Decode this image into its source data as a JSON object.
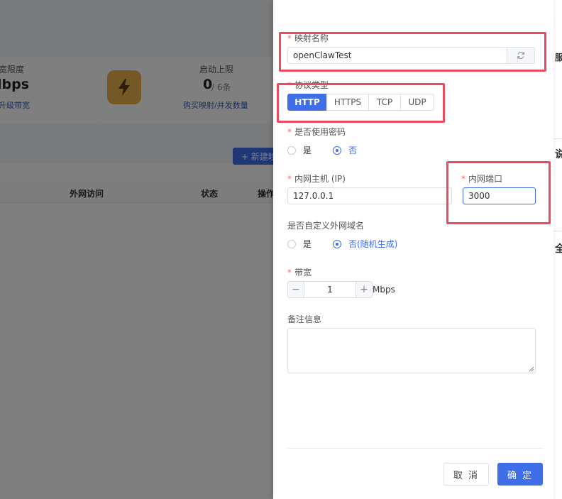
{
  "background": {
    "stat_1": {
      "label": "宽限度",
      "value": "lbps",
      "link": "升级带宽"
    },
    "stat_2": {
      "label": "启动上限",
      "value": "0",
      "suffix": "/ 6条",
      "link": "购买映射/并发数量"
    },
    "new_button": "+ 新建映射",
    "table_headers": [
      "外网访问",
      "状态",
      "操作"
    ],
    "right_edge_items": [
      "服",
      "说",
      "全"
    ]
  },
  "form": {
    "mapping_name": {
      "label": "映射名称",
      "required": true,
      "value": "openClawTest"
    },
    "protocol": {
      "label": "协议类型",
      "required": true,
      "options": [
        "HTTP",
        "HTTPS",
        "TCP",
        "UDP"
      ],
      "selected": "HTTP"
    },
    "use_password": {
      "label": "是否使用密码",
      "required": true,
      "options": [
        "是",
        "否"
      ],
      "selected": "否"
    },
    "lan_host": {
      "label": "内网主机 (IP)",
      "required": true,
      "value": "127.0.0.1"
    },
    "lan_port": {
      "label": "内网端口",
      "required": true,
      "value": "3000"
    },
    "custom_domain": {
      "label": "是否自定义外网域名",
      "required": false,
      "options": [
        "是",
        "否(随机生成)"
      ],
      "selected": "否(随机生成)"
    },
    "bandwidth": {
      "label": "带宽",
      "required": true,
      "value": "1",
      "unit": "Mbps",
      "decrement": "−",
      "increment": "+"
    },
    "remark": {
      "label": "备注信息",
      "required": false,
      "value": ""
    }
  },
  "footer": {
    "cancel_label": "取 消",
    "confirm_label": "确 定"
  },
  "colors": {
    "primary": "#3f6ee8",
    "required_star": "#f56c6c",
    "highlight_box": "#ec4a5d",
    "bolt_tile": "#e8b04c"
  }
}
